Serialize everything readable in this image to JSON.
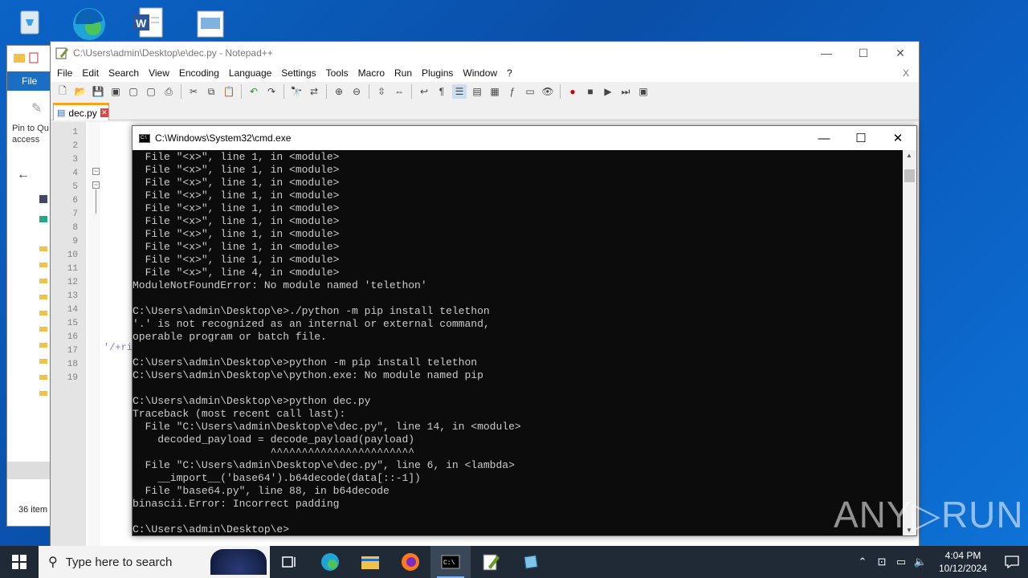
{
  "desktop": {
    "icons": [
      "recycle-bin-icon",
      "edge-icon",
      "word-doc-icon",
      "image-file-icon"
    ]
  },
  "explorer": {
    "file_tab": "File",
    "pin_label": "Pin to Qu access",
    "status": "36 item"
  },
  "notepadpp": {
    "title": "C:\\Users\\admin\\Desktop\\e\\dec.py - Notepad++",
    "menu": [
      "File",
      "Edit",
      "Search",
      "View",
      "Encoding",
      "Language",
      "Settings",
      "Tools",
      "Macro",
      "Run",
      "Plugins",
      "Window",
      "?"
    ],
    "close_doc": "X",
    "tab_label": "dec.py",
    "line_numbers": [
      "1",
      "2",
      "3",
      "4",
      "5",
      "6",
      "7",
      "8",
      "9",
      "10",
      "11",
      "12",
      "13",
      "14",
      "15",
      "16",
      "17",
      "18",
      "19"
    ],
    "line11_snippet": "'/+ri"
  },
  "cmd": {
    "title": "C:\\Windows\\System32\\cmd.exe",
    "lines": [
      "  File \"<x>\", line 1, in <module>",
      "  File \"<x>\", line 1, in <module>",
      "  File \"<x>\", line 1, in <module>",
      "  File \"<x>\", line 1, in <module>",
      "  File \"<x>\", line 1, in <module>",
      "  File \"<x>\", line 1, in <module>",
      "  File \"<x>\", line 1, in <module>",
      "  File \"<x>\", line 1, in <module>",
      "  File \"<x>\", line 1, in <module>",
      "  File \"<x>\", line 4, in <module>",
      "ModuleNotFoundError: No module named 'telethon'",
      "",
      "C:\\Users\\admin\\Desktop\\e>./python -m pip install telethon",
      "'.' is not recognized as an internal or external command,",
      "operable program or batch file.",
      "",
      "C:\\Users\\admin\\Desktop\\e>python -m pip install telethon",
      "C:\\Users\\admin\\Desktop\\e\\python.exe: No module named pip",
      "",
      "C:\\Users\\admin\\Desktop\\e>python dec.py",
      "Traceback (most recent call last):",
      "  File \"C:\\Users\\admin\\Desktop\\e\\dec.py\", line 14, in <module>",
      "    decoded_payload = decode_payload(payload)",
      "                      ^^^^^^^^^^^^^^^^^^^^^^^",
      "  File \"C:\\Users\\admin\\Desktop\\e\\dec.py\", line 6, in <lambda>",
      "    __import__('base64').b64decode(data[::-1])",
      "  File \"base64.py\", line 88, in b64decode",
      "binascii.Error: Incorrect padding",
      "",
      "C:\\Users\\admin\\Desktop\\e>"
    ]
  },
  "taskbar": {
    "search_placeholder": "Type here to search",
    "apps": [
      "task-view-icon",
      "edge-icon",
      "file-explorer-icon",
      "firefox-icon",
      "cmd-icon",
      "notepadpp-icon",
      "notepad-icon"
    ],
    "time": "4:04 PM",
    "date": "10/12/2024"
  },
  "watermark": "ANY RUN"
}
